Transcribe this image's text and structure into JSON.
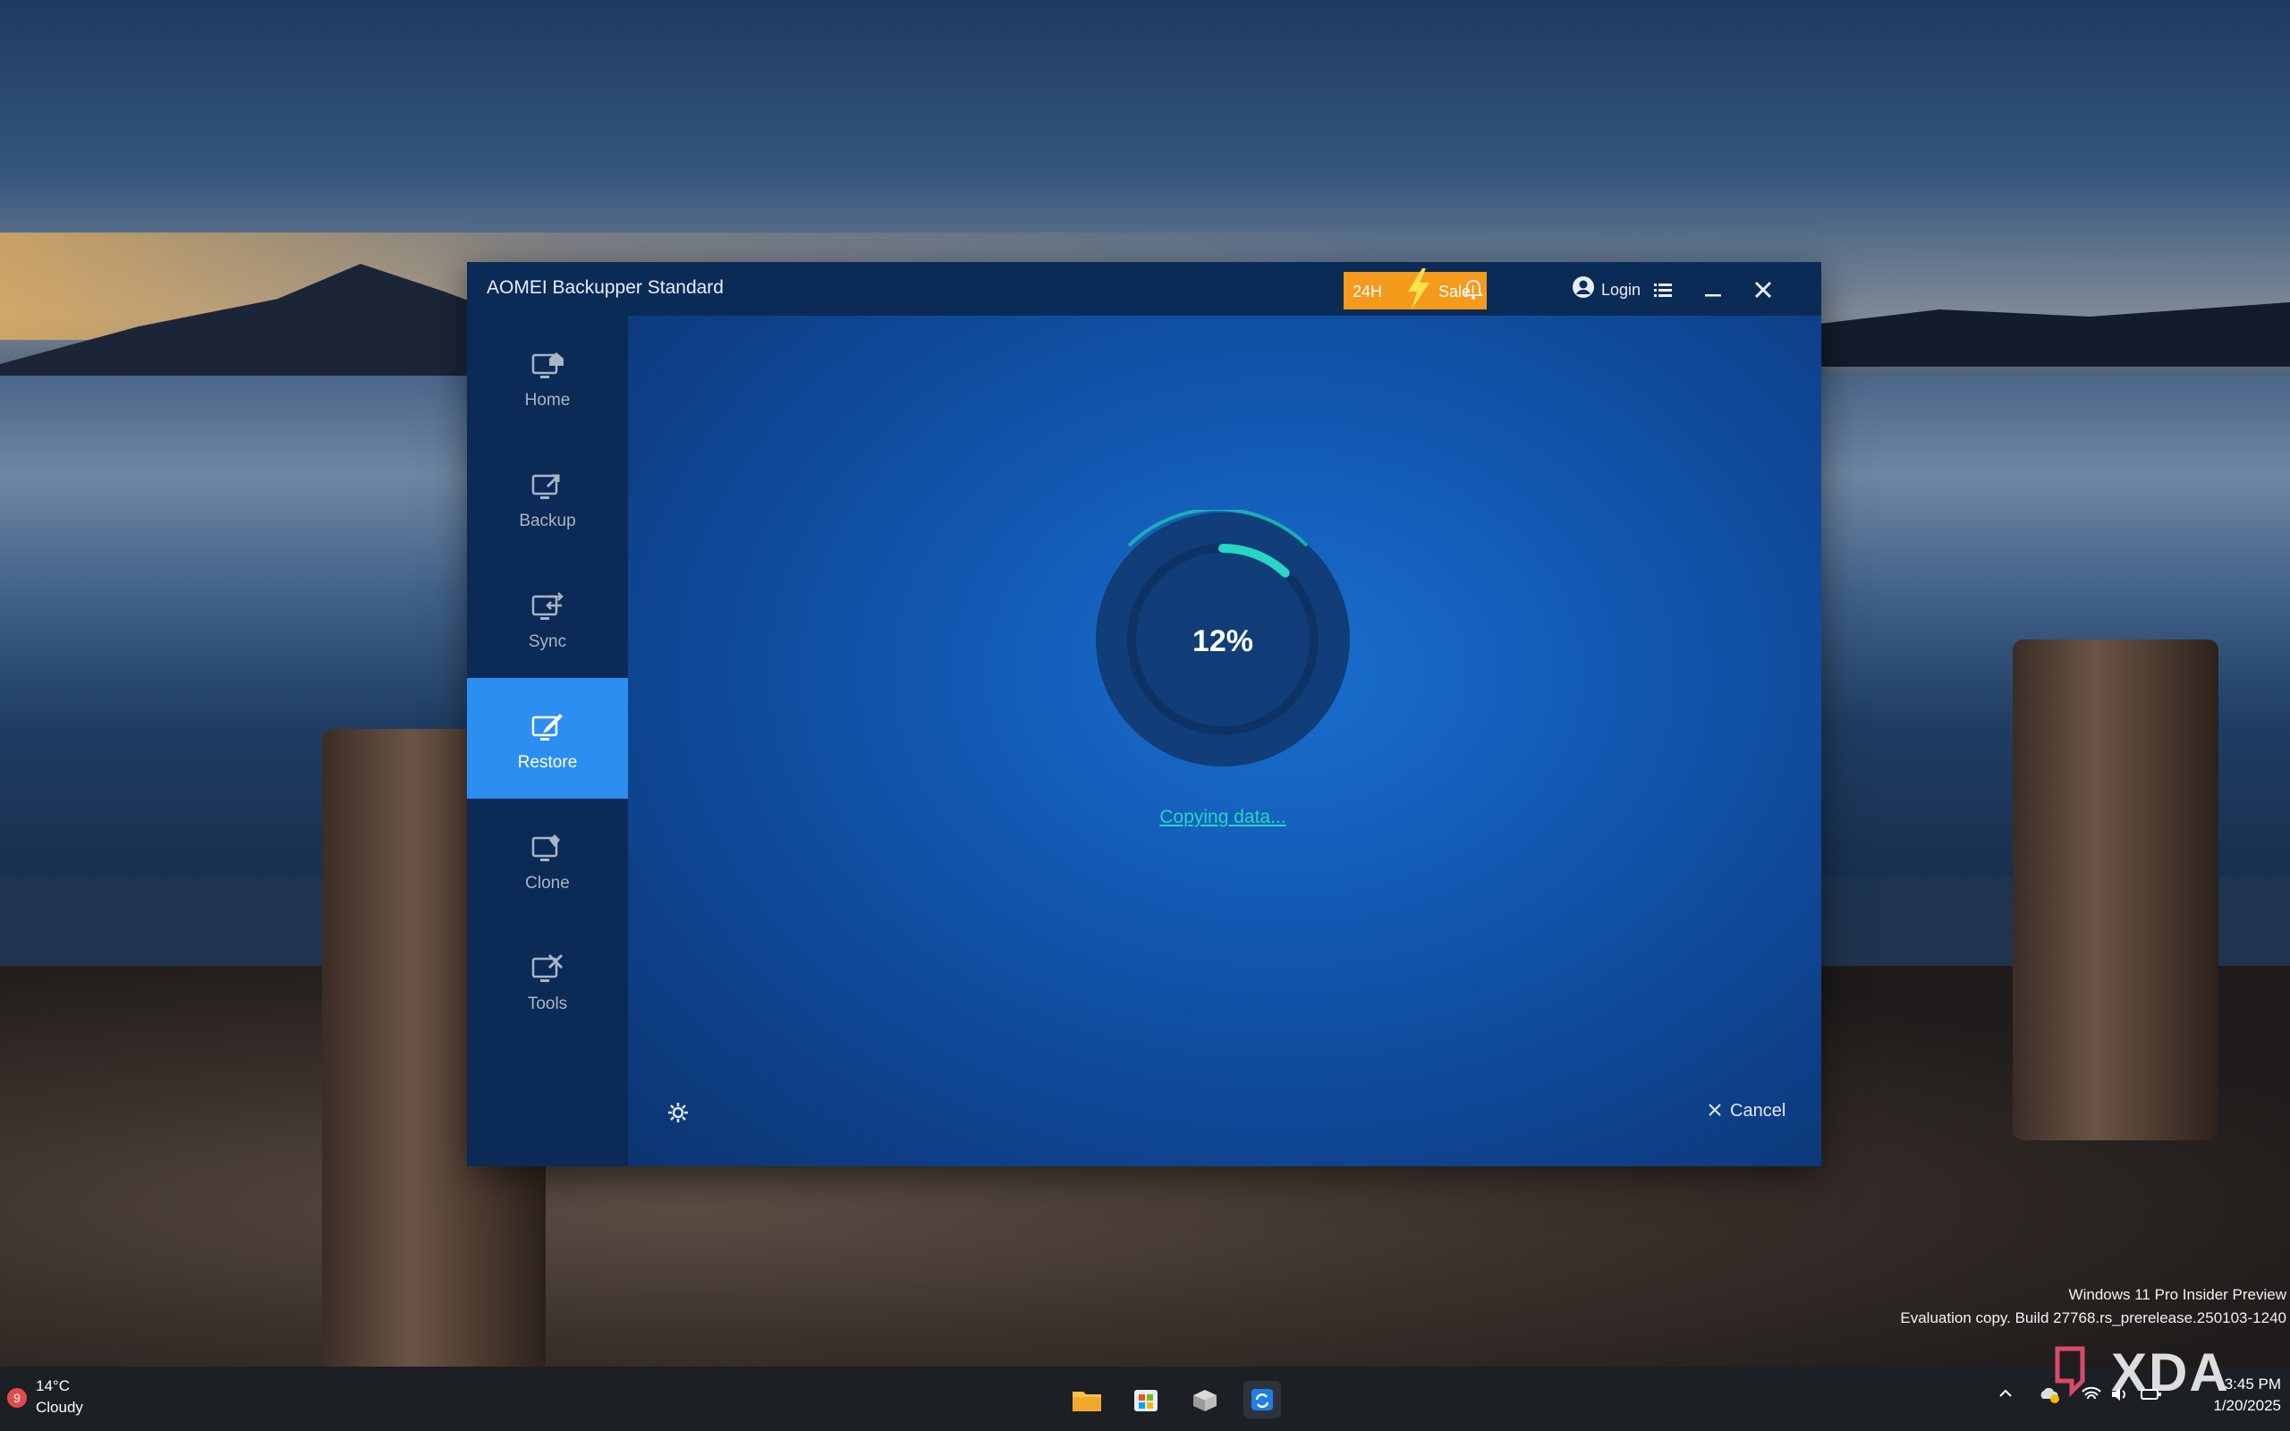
{
  "window": {
    "title": "AOMEI Backupper Standard",
    "promo": {
      "left": "24H",
      "right": "Sale!"
    },
    "login_label": "Login",
    "icons": {
      "bell": "bell-icon",
      "account": "account-icon",
      "menu": "menu-icon",
      "minimize": "minimize-icon",
      "close": "close-icon"
    }
  },
  "sidebar": {
    "items": [
      {
        "label": "Home",
        "icon": "home-icon",
        "active": false
      },
      {
        "label": "Backup",
        "icon": "backup-icon",
        "active": false
      },
      {
        "label": "Sync",
        "icon": "sync-icon",
        "active": false
      },
      {
        "label": "Restore",
        "icon": "restore-icon",
        "active": true
      },
      {
        "label": "Clone",
        "icon": "clone-icon",
        "active": false
      },
      {
        "label": "Tools",
        "icon": "tools-icon",
        "active": false
      }
    ]
  },
  "progress": {
    "percent_text": "12%",
    "fraction": 0.12,
    "status": "Copying data...",
    "accent": "#27d6c4"
  },
  "footer": {
    "cancel_label": "Cancel",
    "settings_icon": "gear-icon"
  },
  "desktop": {
    "watermark_line1": "Windows 11 Pro Insider Preview",
    "watermark_line2": "Evaluation copy. Build 27768.rs_prerelease.250103-1240",
    "brand": "XDA"
  },
  "taskbar": {
    "weather": {
      "badge": "9",
      "temp": "14°C",
      "condition": "Cloudy"
    },
    "apps": [
      "file-explorer-icon",
      "store-icon",
      "app-installer-icon",
      "aomei-backupper-icon"
    ],
    "clock": {
      "time": "3:45 PM",
      "date": "1/20/2025"
    }
  },
  "colors": {
    "sidebar_active": "#2b8ef0",
    "sale": "#f59a1b",
    "window_bg": "#0c2f62"
  }
}
